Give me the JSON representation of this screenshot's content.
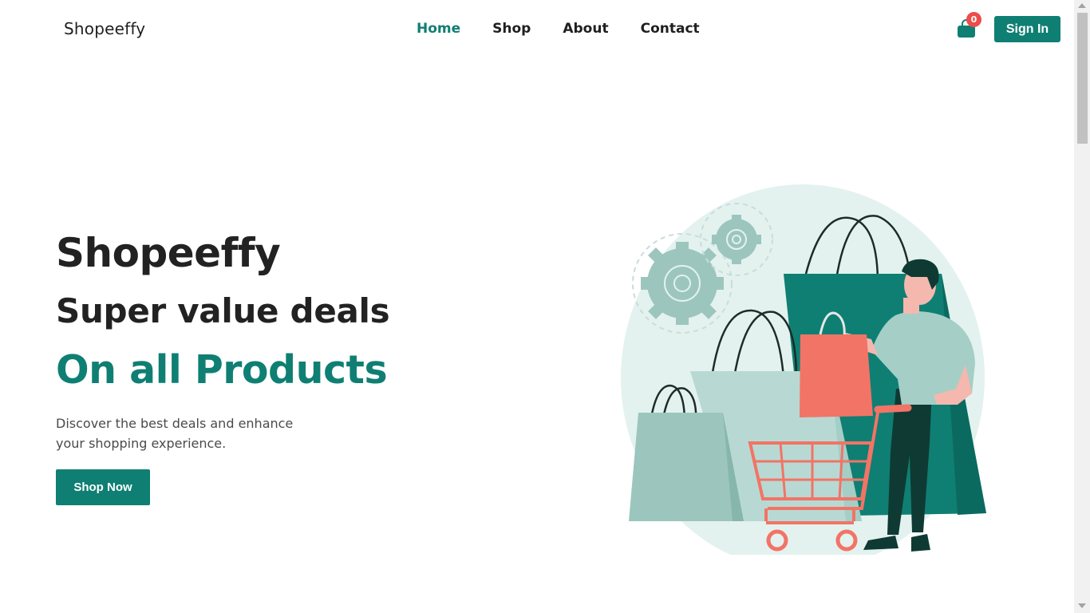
{
  "brand": {
    "name": "Shopeeffy"
  },
  "nav": {
    "items": [
      {
        "label": "Home",
        "active": true
      },
      {
        "label": "Shop",
        "active": false
      },
      {
        "label": "About",
        "active": false
      },
      {
        "label": "Contact",
        "active": false
      }
    ]
  },
  "cart": {
    "icon": "shopping-bag-icon",
    "count": "0"
  },
  "auth": {
    "signin_label": "Sign In"
  },
  "hero": {
    "title": "Shopeeffy",
    "subtitle": "Super value deals",
    "highlight": "On all Products",
    "description": "Discover the best deals and enhance your shopping experience.",
    "cta_label": "Shop Now"
  },
  "colors": {
    "accent": "#0f7f73",
    "badge": "#ee4b4b",
    "illustration_bg": "#e3f2ef",
    "bag_light": "#9cc6bd",
    "bag_dark": "#0f7f73",
    "coral": "#f27466"
  }
}
